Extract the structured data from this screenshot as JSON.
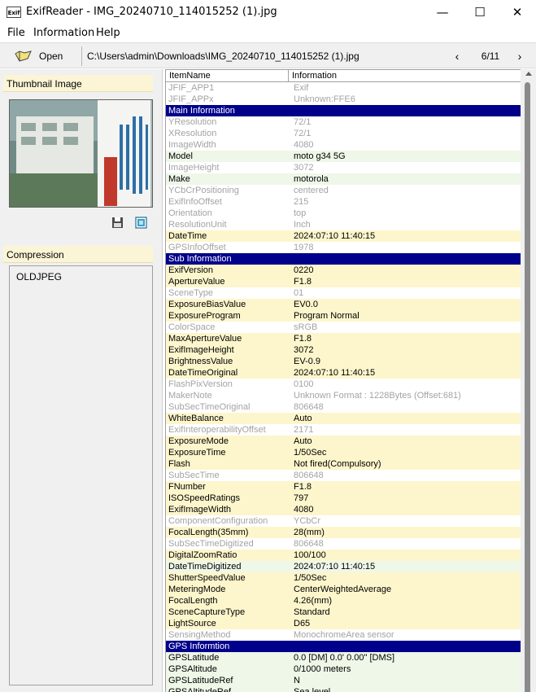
{
  "window": {
    "icon_text": "Exif",
    "title": "ExifReader - IMG_20240710_114015252 (1).jpg",
    "minimize": "—",
    "maximize": "☐",
    "close": "✕"
  },
  "menu": [
    "File",
    "Information",
    "Help"
  ],
  "toolbar": {
    "open_label": "Open",
    "path": "C:\\Users\\admin\\Downloads\\IMG_20240710_114015252 (1).jpg",
    "prev": "‹",
    "next": "›",
    "page": "6/11"
  },
  "left_panel": {
    "thumbnail_header": "Thumbnail Image",
    "compression_header": "Compression",
    "compression_value": "OLDJPEG"
  },
  "table": {
    "col1": "ItemName",
    "col2": "Information",
    "rows": [
      {
        "name": "JFIF_APP1",
        "value": "Exif",
        "style": "w dim"
      },
      {
        "name": "JFIF_APPx",
        "value": "Unknown:FFE6",
        "style": "w dim"
      },
      {
        "name": "Main Information",
        "value": "",
        "style": "sec"
      },
      {
        "name": "YResolution",
        "value": "72/1",
        "style": "w dim"
      },
      {
        "name": "XResolution",
        "value": "72/1",
        "style": "w dim"
      },
      {
        "name": "ImageWidth",
        "value": "4080",
        "style": "w dim"
      },
      {
        "name": "Model",
        "value": "moto g34 5G",
        "style": "g"
      },
      {
        "name": "ImageHeight",
        "value": "3072",
        "style": "w dim"
      },
      {
        "name": "Make",
        "value": "motorola",
        "style": "g"
      },
      {
        "name": "YCbCrPositioning",
        "value": "centered",
        "style": "w dim"
      },
      {
        "name": "ExifInfoOffset",
        "value": "215",
        "style": "w dim"
      },
      {
        "name": "Orientation",
        "value": "top",
        "style": "w dim"
      },
      {
        "name": "ResolutionUnit",
        "value": "Inch",
        "style": "w dim"
      },
      {
        "name": "DateTime",
        "value": "2024:07:10 11:40:15",
        "style": "y"
      },
      {
        "name": "GPSInfoOffset",
        "value": "1978",
        "style": "w dim"
      },
      {
        "name": "Sub Information",
        "value": "",
        "style": "sec"
      },
      {
        "name": "ExifVersion",
        "value": "0220",
        "style": "y"
      },
      {
        "name": "ApertureValue",
        "value": "F1.8",
        "style": "y"
      },
      {
        "name": "SceneType",
        "value": "01",
        "style": "w dim"
      },
      {
        "name": "ExposureBiasValue",
        "value": "EV0.0",
        "style": "y"
      },
      {
        "name": "ExposureProgram",
        "value": "Program Normal",
        "style": "y"
      },
      {
        "name": "ColorSpace",
        "value": "sRGB",
        "style": "w dim"
      },
      {
        "name": "MaxApertureValue",
        "value": "F1.8",
        "style": "y"
      },
      {
        "name": "ExifImageHeight",
        "value": "3072",
        "style": "y"
      },
      {
        "name": "BrightnessValue",
        "value": "EV-0.9",
        "style": "y"
      },
      {
        "name": "DateTimeOriginal",
        "value": "2024:07:10 11:40:15",
        "style": "y"
      },
      {
        "name": "FlashPixVersion",
        "value": "0100",
        "style": "w dim"
      },
      {
        "name": "MakerNote",
        "value": "Unknown Format : 1228Bytes (Offset:681)",
        "style": "w dim"
      },
      {
        "name": "SubSecTimeOriginal",
        "value": "806648",
        "style": "w dim"
      },
      {
        "name": "WhiteBalance",
        "value": "Auto",
        "style": "y"
      },
      {
        "name": "ExifInteroperabilityOffset",
        "value": "2171",
        "style": "w dim"
      },
      {
        "name": "ExposureMode",
        "value": "Auto",
        "style": "y"
      },
      {
        "name": "ExposureTime",
        "value": "1/50Sec",
        "style": "y"
      },
      {
        "name": "Flash",
        "value": "Not fired(Compulsory)",
        "style": "y"
      },
      {
        "name": "SubSecTime",
        "value": "806648",
        "style": "w dim"
      },
      {
        "name": "FNumber",
        "value": "F1.8",
        "style": "y"
      },
      {
        "name": "ISOSpeedRatings",
        "value": "797",
        "style": "y"
      },
      {
        "name": "ExifImageWidth",
        "value": "4080",
        "style": "y"
      },
      {
        "name": "ComponentConfiguration",
        "value": "YCbCr",
        "style": "w dim"
      },
      {
        "name": "FocalLength(35mm)",
        "value": "28(mm)",
        "style": "y"
      },
      {
        "name": "SubSecTimeDigitized",
        "value": "806648",
        "style": "w dim"
      },
      {
        "name": "DigitalZoomRatio",
        "value": "100/100",
        "style": "y"
      },
      {
        "name": "DateTimeDigitized",
        "value": "2024:07:10 11:40:15",
        "style": "g"
      },
      {
        "name": "ShutterSpeedValue",
        "value": "1/50Sec",
        "style": "y"
      },
      {
        "name": "MeteringMode",
        "value": "CenterWeightedAverage",
        "style": "y"
      },
      {
        "name": "FocalLength",
        "value": "4.26(mm)",
        "style": "y"
      },
      {
        "name": "SceneCaptureType",
        "value": "Standard",
        "style": "y"
      },
      {
        "name": "LightSource",
        "value": "D65",
        "style": "y"
      },
      {
        "name": "SensingMethod",
        "value": "MonochromeArea sensor",
        "style": "w dim"
      },
      {
        "name": "GPS Informtion",
        "value": "",
        "style": "sec"
      },
      {
        "name": "GPSLatitude",
        "value": "0.0 [DM]   0.0' 0.00\" [DMS]",
        "style": "g"
      },
      {
        "name": "GPSAltitude",
        "value": "0/1000 meters",
        "style": "g"
      },
      {
        "name": "GPSLatitudeRef",
        "value": "N",
        "style": "g"
      },
      {
        "name": "GPSAltitudeRef",
        "value": "Sea level",
        "style": "g"
      }
    ]
  }
}
